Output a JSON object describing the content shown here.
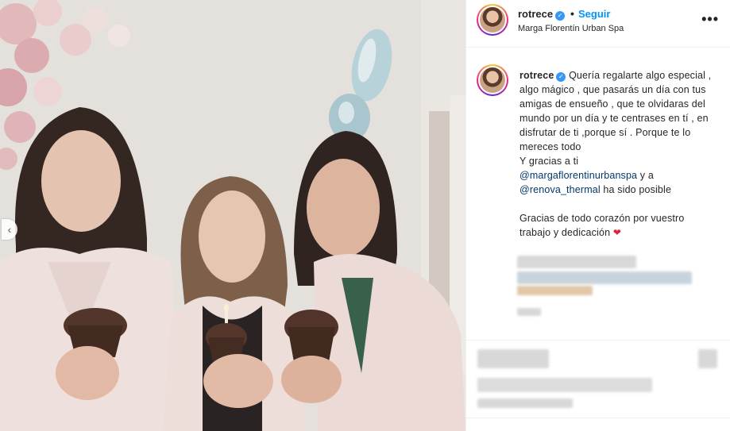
{
  "post": {
    "username": "rotrece",
    "verified_mark": "✓",
    "separator": "•",
    "follow_label": "Seguir",
    "location": "Marga Florentín Urban Spa",
    "more_icon": "•••"
  },
  "caption": {
    "username": "rotrece",
    "text_1": "Quería regalarte algo especial , algo mágico , que pasarás un día con tus amigas de ensueño , que te olvidaras del mundo por un día y te centrases en tí , en disfrutar de ti ,porque sí . Porque te lo mereces todo",
    "text_2": "Y gracias a ti",
    "mention_1": "@margaflorentinurbanspa",
    "text_3": " y a",
    "mention_2": "@renova_thermal",
    "text_4": " ha sido posible",
    "text_5": "Gracias de todo corazón por vuestro trabajo y dedicación",
    "heart": "❤"
  },
  "carousel": {
    "prev_icon": "‹"
  },
  "icons": {
    "verified": "verified-badge-icon",
    "more": "more-options-icon",
    "prev": "chevron-left-icon",
    "heart": "heart-emoji-icon"
  },
  "colors": {
    "link": "#0095f6",
    "mention": "#00376b",
    "verified": "#3897f0",
    "divider": "#efefef"
  }
}
